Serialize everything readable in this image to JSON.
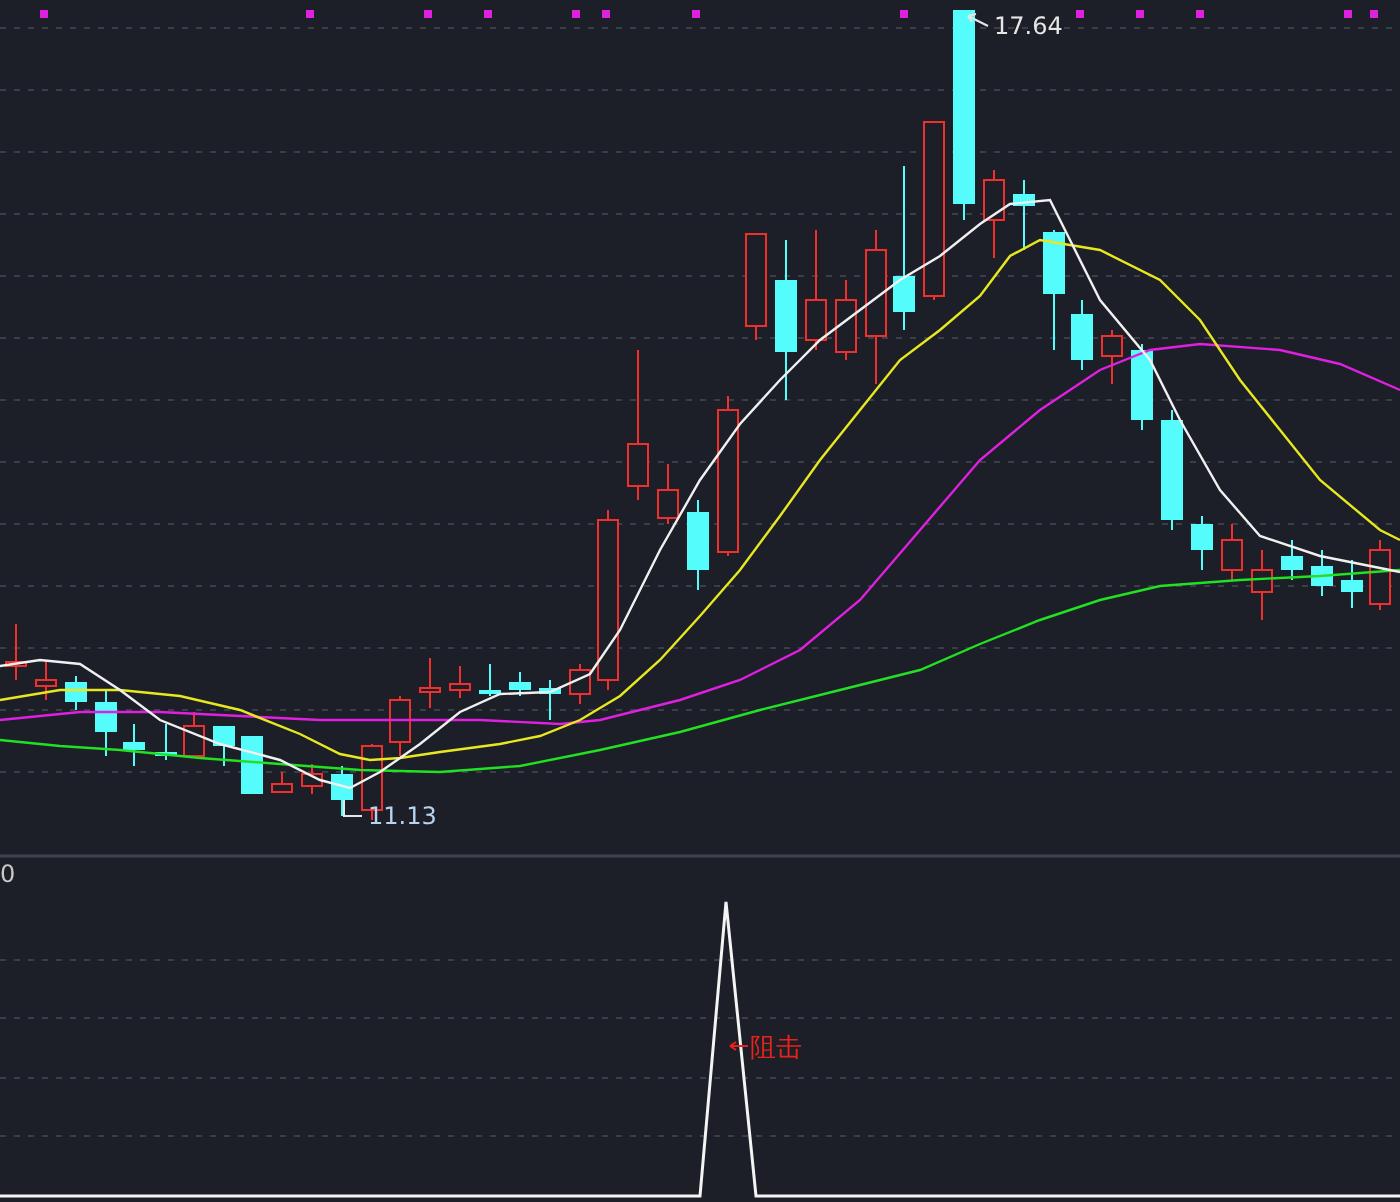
{
  "price_chart": {
    "high_label": "17.64",
    "low_label": "11.13"
  },
  "indicator_panel": {
    "axis_label": "0",
    "signal_label": "阻击"
  }
}
